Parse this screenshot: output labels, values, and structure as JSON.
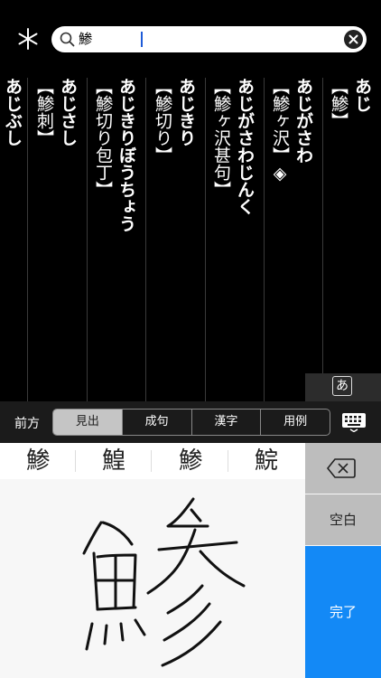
{
  "search": {
    "query": "鯵"
  },
  "results": [
    {
      "reading": "あじ",
      "kanji": "【鯵】"
    },
    {
      "reading": "あじがさわ",
      "kanji": "【鯵ヶ沢】◈"
    },
    {
      "reading": "あじがさわじんく",
      "kanji": "【鯵ヶ沢甚句】"
    },
    {
      "reading": "あじきり",
      "kanji": "【鯵切り】"
    },
    {
      "reading": "あじきりぼうちょう",
      "kanji": "【鯵切り包丁】"
    },
    {
      "reading": "あじさし",
      "kanji": "【鯵刺】"
    },
    {
      "reading": "あじぶし",
      "kanji": ""
    }
  ],
  "kana_badge": "あ",
  "modebar": {
    "prefix": "前方",
    "tabs": [
      "見出",
      "成句",
      "漢字",
      "用例"
    ],
    "active": 0
  },
  "candidates": [
    "鯵",
    "鰉",
    "鯵",
    "鯇"
  ],
  "keys": {
    "space": "空白",
    "done": "完了"
  }
}
